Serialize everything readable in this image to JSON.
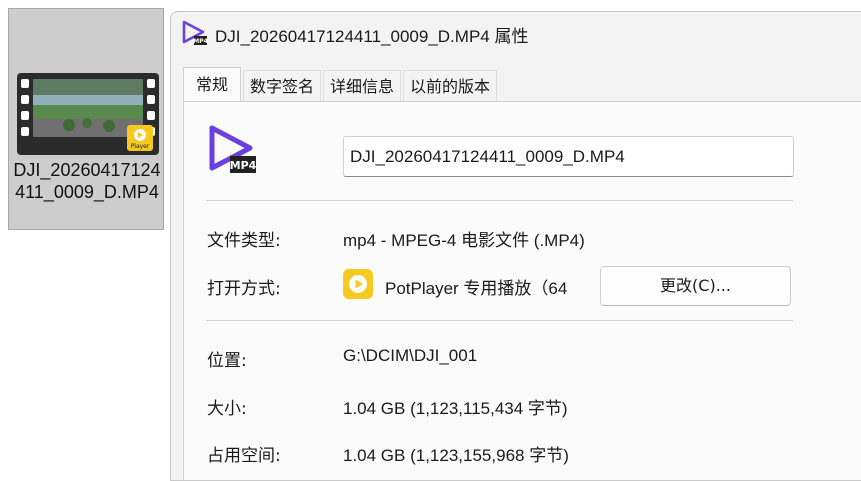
{
  "desktop": {
    "file_name": "DJI_20260417124411_0009_D.MP4",
    "badge_label": "Player"
  },
  "dialog": {
    "title": "DJI_20260417124411_0009_D.MP4 属性",
    "tabs": [
      {
        "label": "常规",
        "active": true
      },
      {
        "label": "数字签名",
        "active": false
      },
      {
        "label": "详细信息",
        "active": false
      },
      {
        "label": "以前的版本",
        "active": false
      }
    ],
    "icon_badge": "MP4",
    "general": {
      "file_name_value": "DJI_20260417124411_0009_D.MP4",
      "file_type_label": "文件类型:",
      "file_type_value": "mp4 - MPEG-4 电影文件 (.MP4)",
      "open_with_label": "打开方式:",
      "open_with_value": "PotPlayer 专用播放（64",
      "change_button": "更改(C)...",
      "location_label": "位置:",
      "location_value": "G:\\DCIM\\DJI_001",
      "size_label": "大小:",
      "size_value": "1.04 GB (1,123,115,434 字节)",
      "size_on_disk_label": "占用空间:",
      "size_on_disk_value": "1.04 GB (1,123,155,968 字节)"
    }
  },
  "colors": {
    "accent_purple": "#6b3fe0",
    "potplayer_yellow": "#f7c81e"
  }
}
